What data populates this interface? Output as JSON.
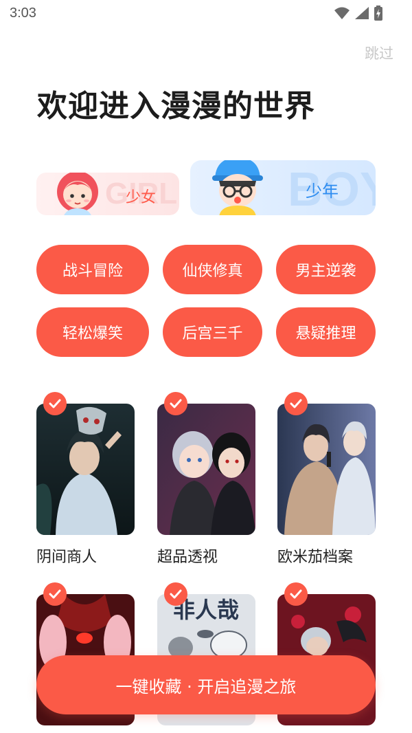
{
  "status_bar": {
    "time": "3:03"
  },
  "header": {
    "skip_label": "跳过",
    "title": "欢迎进入漫漫的世界"
  },
  "gender": {
    "girl": {
      "label": "少女",
      "watermark": "GIRL",
      "selected": false
    },
    "boy": {
      "label": "少年",
      "watermark": "BOY",
      "selected": true
    }
  },
  "tags": [
    "战斗冒险",
    "仙侠修真",
    "男主逆袭",
    "轻松爆笑",
    "后宫三千",
    "悬疑推理"
  ],
  "comics": [
    {
      "name": "阴间商人",
      "checked": true
    },
    {
      "name": "超品透视",
      "checked": true
    },
    {
      "name": "欧米茄档案",
      "checked": true
    },
    {
      "name": "",
      "checked": true
    },
    {
      "name": "",
      "cover_text": "非人哉",
      "checked": true
    },
    {
      "name": "",
      "checked": true
    }
  ],
  "footer": {
    "collect_label": "一键收藏 · 开启追漫之旅"
  },
  "colors": {
    "accent": "#fb5a47",
    "boy_blue": "#2d8cf0",
    "girl_pink": "#ff5a4a"
  }
}
